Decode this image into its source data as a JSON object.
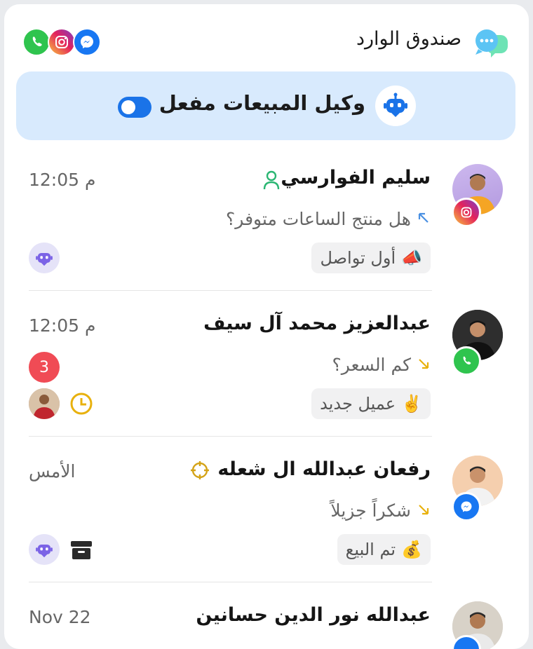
{
  "header": {
    "title": "صندوق الوارد",
    "socials": [
      "whatsapp-icon",
      "instagram-icon",
      "messenger-icon"
    ]
  },
  "agent": {
    "label": "وكيل المبيعات مفعل",
    "enabled": true
  },
  "conversations": [
    {
      "name": "سليم الفوارسي",
      "time": "12:05 م",
      "message": "هل منتج الساعات متوفر؟",
      "direction": "outgoing",
      "tag": "أول تواصل",
      "tag_emoji": "📣",
      "channel": "instagram",
      "name_icon": "person-icon"
    },
    {
      "name": "عبدالعزيز محمد آل سيف",
      "time": "12:05 م",
      "message": "كم السعر؟",
      "direction": "incoming",
      "tag": "عميل جديد",
      "tag_emoji": "✌️",
      "channel": "whatsapp",
      "unread": "3"
    },
    {
      "name": "رفعان عبدالله ال شعله",
      "time": "الأمس",
      "message": "شكراً جزيلاً",
      "direction": "incoming",
      "tag": "تم البيع",
      "tag_emoji": "💰",
      "channel": "messenger",
      "name_icon": "target-icon"
    },
    {
      "name": "عبدالله نور الدين حسانين",
      "time": "Nov 22",
      "channel": "messenger"
    }
  ],
  "colors": {
    "accent": "#1a73e8",
    "agent_bg": "#d8eafd",
    "unread": "#f04b55",
    "arrow_out": "#4a90e2",
    "arrow_in": "#e8b10e"
  }
}
